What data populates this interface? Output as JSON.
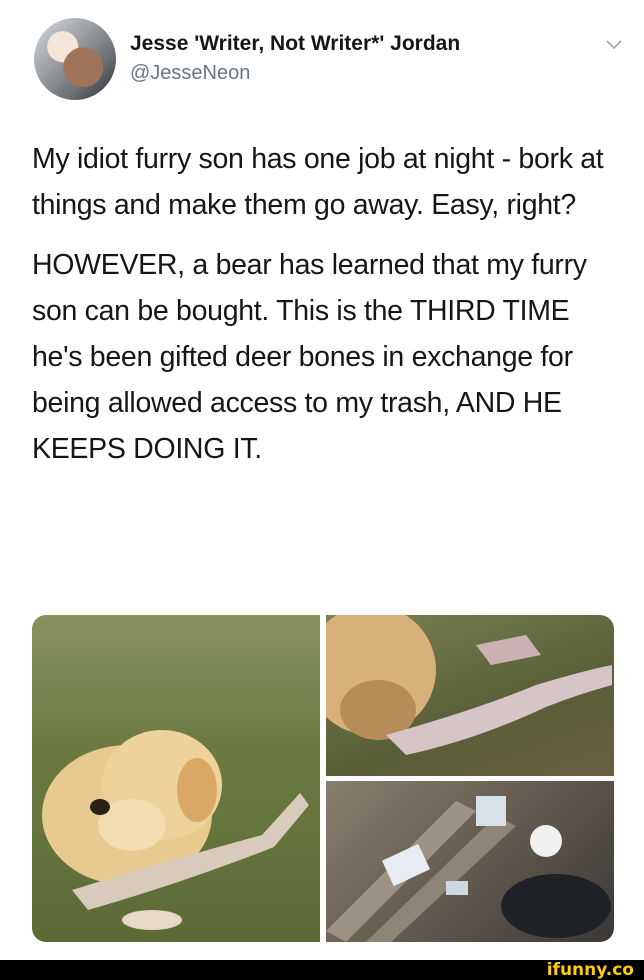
{
  "tweet": {
    "display_name": "Jesse 'Writer, Not Writer*' Jordan",
    "handle": "@JesseNeon",
    "menu_icon": "chevron-down-icon",
    "paragraphs": [
      "My idiot furry son has one job at night - bork at things and make them go away. Easy, right?",
      "HOWEVER, a bear has learned that my furry son can be bought. This is the THIRD TIME he's been gifted deer bones in exchange for being allowed access to my trash, AND HE KEEPS DOING IT."
    ]
  },
  "photos": [
    {
      "subject": "dog lying on grass with deer bone"
    },
    {
      "subject": "dog chewing deer bone close-up"
    },
    {
      "subject": "trash scattered on wooden deck"
    }
  ],
  "watermark": {
    "text": "ifunny.co",
    "color": "#ffcc00"
  }
}
